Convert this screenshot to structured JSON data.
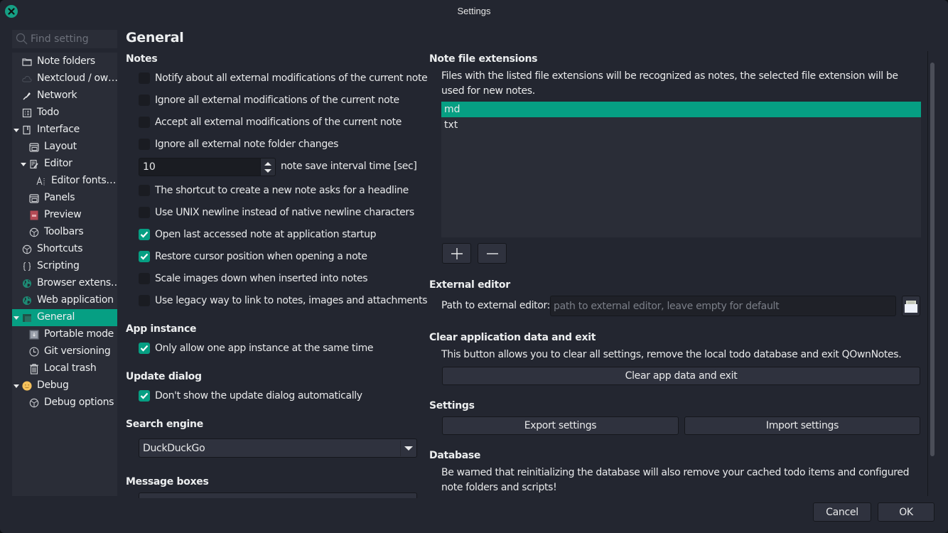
{
  "window": {
    "title": "Settings"
  },
  "sidebar": {
    "search_placeholder": "Find setting",
    "items": [
      {
        "label": "Note folders",
        "icon": "folder-icon",
        "level": 0,
        "expanded": null,
        "selected": false
      },
      {
        "label": "Nextcloud / ow…",
        "icon": "cloud-icon",
        "level": 0,
        "expanded": null,
        "selected": false
      },
      {
        "label": "Network",
        "icon": "network-plug-icon",
        "level": 0,
        "expanded": null,
        "selected": false
      },
      {
        "label": "Todo",
        "icon": "todo-list-icon",
        "level": 0,
        "expanded": null,
        "selected": false
      },
      {
        "label": "Interface",
        "icon": "interface-icon",
        "level": 0,
        "expanded": true,
        "selected": false
      },
      {
        "label": "Layout",
        "icon": "window-layout-icon",
        "level": 1,
        "expanded": null,
        "selected": false
      },
      {
        "label": "Editor",
        "icon": "editor-icon",
        "level": 1,
        "expanded": true,
        "selected": false
      },
      {
        "label": "Editor fonts…",
        "icon": "font-icon",
        "level": 2,
        "expanded": null,
        "selected": false
      },
      {
        "label": "Panels",
        "icon": "window-layout-icon",
        "level": 1,
        "expanded": null,
        "selected": false
      },
      {
        "label": "Preview",
        "icon": "preview-image-icon",
        "level": 1,
        "expanded": null,
        "selected": false
      },
      {
        "label": "Toolbars",
        "icon": "gear-icon",
        "level": 1,
        "expanded": null,
        "selected": false
      },
      {
        "label": "Shortcuts",
        "icon": "gear-icon",
        "level": 0,
        "expanded": null,
        "selected": false
      },
      {
        "label": "Scripting",
        "icon": "braces-icon",
        "level": 0,
        "expanded": null,
        "selected": false
      },
      {
        "label": "Browser extens…",
        "icon": "globe-icon",
        "level": 0,
        "expanded": null,
        "selected": false
      },
      {
        "label": "Web application",
        "icon": "globe-icon",
        "level": 0,
        "expanded": null,
        "selected": false
      },
      {
        "label": "General",
        "icon": "general-window-icon",
        "level": 0,
        "expanded": true,
        "selected": true
      },
      {
        "label": "Portable mode",
        "icon": "usb-drive-icon",
        "level": 1,
        "expanded": null,
        "selected": false
      },
      {
        "label": "Git versioning",
        "icon": "clock-icon",
        "level": 1,
        "expanded": null,
        "selected": false
      },
      {
        "label": "Local trash",
        "icon": "trash-icon",
        "level": 1,
        "expanded": null,
        "selected": false
      },
      {
        "label": "Debug",
        "icon": "smiley-icon",
        "level": 0,
        "expanded": true,
        "selected": false
      },
      {
        "label": "Debug options",
        "icon": "gear-icon",
        "level": 1,
        "expanded": null,
        "selected": false
      }
    ]
  },
  "main": {
    "page_title": "General",
    "notes": {
      "title": "Notes",
      "options_a": [
        {
          "label": "Notify about all external modifications of the current note",
          "checked": false
        },
        {
          "label": "Ignore all external modifications of the current note",
          "checked": false
        },
        {
          "label": "Accept all external modifications of the current note",
          "checked": false
        },
        {
          "label": "Ignore all external note folder changes",
          "checked": false
        }
      ],
      "save_interval": {
        "value": "10",
        "label": "note save interval time [sec]"
      },
      "options_b": [
        {
          "label": "The shortcut to create a new note asks for a headline",
          "checked": false
        },
        {
          "label": "Use UNIX newline instead of native newline characters",
          "checked": false
        },
        {
          "label": "Open last accessed note at application startup",
          "checked": true
        },
        {
          "label": "Restore cursor position when opening a note",
          "checked": true
        },
        {
          "label": "Scale images down when inserted into notes",
          "checked": false
        },
        {
          "label": "Use legacy way to link to notes, images and attachments",
          "checked": false
        }
      ]
    },
    "app_instance": {
      "title": "App instance",
      "option": {
        "label": "Only allow one app instance at the same time",
        "checked": true
      }
    },
    "update_dialog": {
      "title": "Update dialog",
      "option": {
        "label": "Don't show the update dialog automatically",
        "checked": true
      }
    },
    "search_engine": {
      "title": "Search engine",
      "selected": "DuckDuckGo"
    },
    "message_boxes": {
      "title": "Message boxes"
    },
    "note_file_extensions": {
      "title": "Note file extensions",
      "description": "Files with the listed file extensions will be recognized as notes, the selected file extension will be used for new notes.",
      "items": [
        {
          "label": "md",
          "selected": true
        },
        {
          "label": "txt",
          "selected": false
        }
      ],
      "add_label": "+",
      "remove_label": "−"
    },
    "external_editor": {
      "title": "External editor",
      "path_label": "Path to external editor:",
      "path_value": "",
      "path_placeholder": "path to external editor, leave empty for default"
    },
    "clear_data": {
      "title": "Clear application data and exit",
      "description": "This button allows you to clear all settings, remove the local todo database and exit QOwnNotes.",
      "button_label": "Clear app data and exit"
    },
    "settings": {
      "title": "Settings",
      "export_label": "Export settings",
      "import_label": "Import settings"
    },
    "database": {
      "title": "Database",
      "description": "Be warned that reinitializing the database will also remove your cached todo items and configured note folders and scripts!"
    }
  },
  "footer": {
    "cancel_label": "Cancel",
    "ok_label": "OK"
  },
  "colors": {
    "accent": "#069f83",
    "background": "#232630",
    "panel": "#2a2d37",
    "button": "#2f323e"
  }
}
